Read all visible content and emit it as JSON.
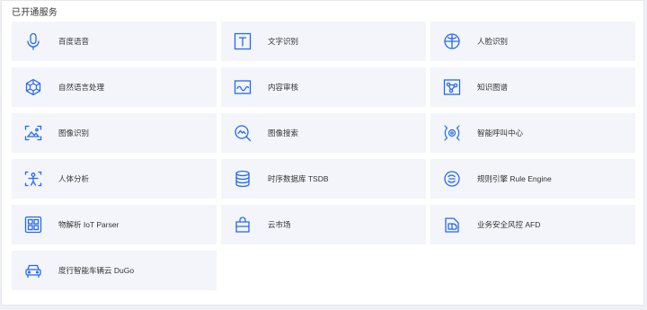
{
  "section_title": "已开通服务",
  "colors": {
    "icon": "#2468f2",
    "tile_bg": "#f3f5fa"
  },
  "services": [
    {
      "label": "百度语音",
      "icon": "microphone-icon"
    },
    {
      "label": "文字识别",
      "icon": "text-recognition-icon"
    },
    {
      "label": "人脸识别",
      "icon": "face-recognition-icon"
    },
    {
      "label": "自然语言处理",
      "icon": "nlp-icon"
    },
    {
      "label": "内容审核",
      "icon": "content-review-icon"
    },
    {
      "label": "知识图谱",
      "icon": "knowledge-graph-icon"
    },
    {
      "label": "图像识别",
      "icon": "image-recognition-icon"
    },
    {
      "label": "图像搜索",
      "icon": "image-search-icon"
    },
    {
      "label": "智能呼叫中心",
      "icon": "call-center-icon"
    },
    {
      "label": "人体分析",
      "icon": "body-analysis-icon"
    },
    {
      "label": "时序数据库 TSDB",
      "icon": "database-icon"
    },
    {
      "label": "规则引擎 Rule Engine",
      "icon": "rule-engine-icon"
    },
    {
      "label": "物解析 IoT Parser",
      "icon": "iot-parser-icon"
    },
    {
      "label": "云市场",
      "icon": "shopping-bag-icon"
    },
    {
      "label": "业务安全风控 AFD",
      "icon": "risk-control-icon"
    },
    {
      "label": "度行智能车辆云 DuGo",
      "icon": "car-icon"
    }
  ]
}
